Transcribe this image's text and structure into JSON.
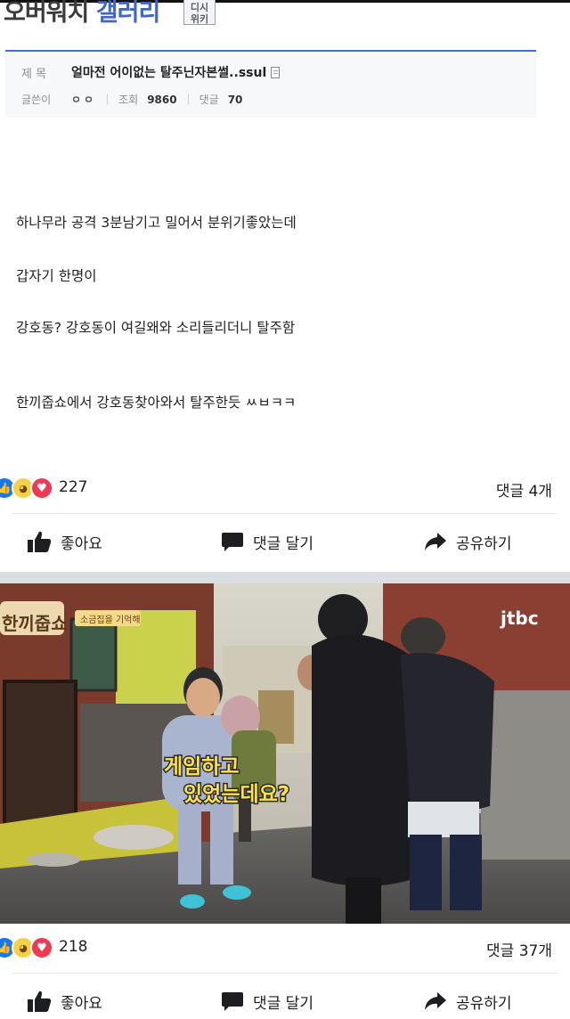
{
  "gallery": {
    "title_part1": "오버워치",
    "title_part2": "갤러리",
    "badge_line1": "디시",
    "badge_line2": "위키"
  },
  "post": {
    "title_label": "제 목",
    "title": "얼마전 어이없는 탈주닌자본썰..ssul",
    "author_label": "글쓴이",
    "author": "ㅇㅇ",
    "views_label": "조회",
    "views": "9860",
    "comments_label": "댓글",
    "comments": "70",
    "body_lines": [
      "하나무라 공격 3분남기고 밀어서 분위기좋았는데",
      "갑자기 한명이",
      "강호동? 강호동이 여길왜와 소리들리더니 탈주함",
      "한끼줍쇼에서 강호동찾아와서 탈주한듯 ㅆㅂㅋㅋ"
    ]
  },
  "feed": [
    {
      "reaction_count": "227",
      "comment_count": "댓글 4개"
    },
    {
      "reaction_count": "218",
      "comment_count": "댓글 37개"
    }
  ],
  "actions": {
    "like": "좋아요",
    "comment": "댓글 달기",
    "share": "공유하기"
  },
  "reaction_icons": [
    "like-icon",
    "haha-icon",
    "love-icon"
  ],
  "video": {
    "logo_text": "한끼줍쇼",
    "banner_text": "소금집을 기억해",
    "channel_text": "jtbc",
    "caption_line1": "게임하고",
    "caption_line2": "있었는데요?"
  },
  "colors": {
    "link_blue": "#3e67c9",
    "header_rule": "#4a6fcf",
    "like_blue": "#1877f2",
    "love_red": "#ef3a54",
    "haha_yellow": "#f7d047"
  }
}
